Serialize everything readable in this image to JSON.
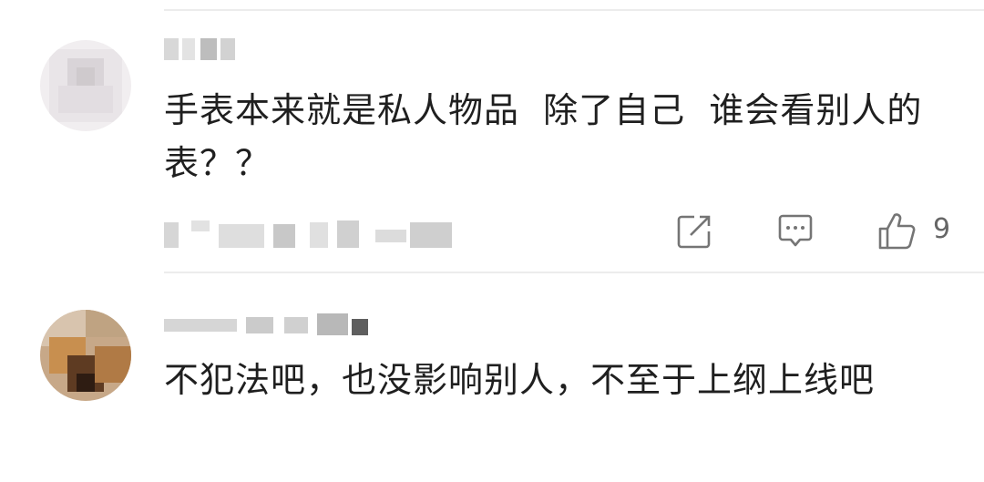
{
  "comments": [
    {
      "text": "手表本来就是私人物品  除了自己  谁会看别人的表？？",
      "actions": {
        "like_count": "9"
      }
    },
    {
      "text": "不犯法吧，也没影响别人，不至于上纲上线吧"
    }
  ],
  "icons": {
    "share": "share-icon",
    "comment": "comment-icon",
    "like": "thumbs-up-icon"
  },
  "colors": {
    "text": "#1f1f1f",
    "icon": "#757575",
    "divider": "#ececec"
  }
}
